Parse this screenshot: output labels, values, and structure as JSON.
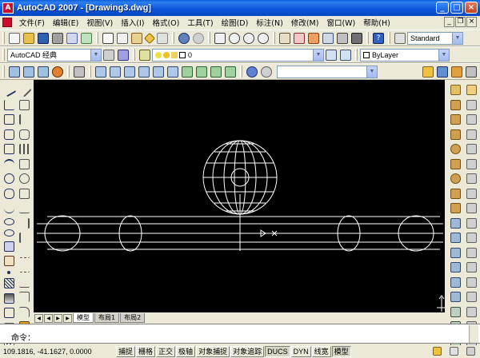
{
  "title": "AutoCAD 2007 - [Drawing3.dwg]",
  "app_icon": "autocad-logo-icon",
  "menus": [
    "文件(F)",
    "编辑(E)",
    "视图(V)",
    "插入(I)",
    "格式(O)",
    "工具(T)",
    "绘图(D)",
    "标注(N)",
    "修改(M)",
    "窗口(W)",
    "帮助(H)"
  ],
  "workspace": "AutoCAD 经典",
  "text_style": "Standard",
  "layer": "0",
  "color": "ByLayer",
  "layout_tabs": [
    "模型",
    "布局1",
    "布局2"
  ],
  "command_prompt": "命令：",
  "coordinates": "109.1816,  -41.1627, 0.0000",
  "status_toggles": [
    {
      "label": "捕捉",
      "on": false
    },
    {
      "label": "栅格",
      "on": false
    },
    {
      "label": "正交",
      "on": false
    },
    {
      "label": "极轴",
      "on": false
    },
    {
      "label": "对象捕捉",
      "on": false
    },
    {
      "label": "对象追踪",
      "on": false
    },
    {
      "label": "DUCS",
      "on": true
    },
    {
      "label": "DYN",
      "on": false
    },
    {
      "label": "线宽",
      "on": false
    },
    {
      "label": "模型",
      "on": true
    }
  ],
  "colors": {
    "accent": "#0a5fd8",
    "canvas": "#000000",
    "drawing": "#ffffff"
  }
}
